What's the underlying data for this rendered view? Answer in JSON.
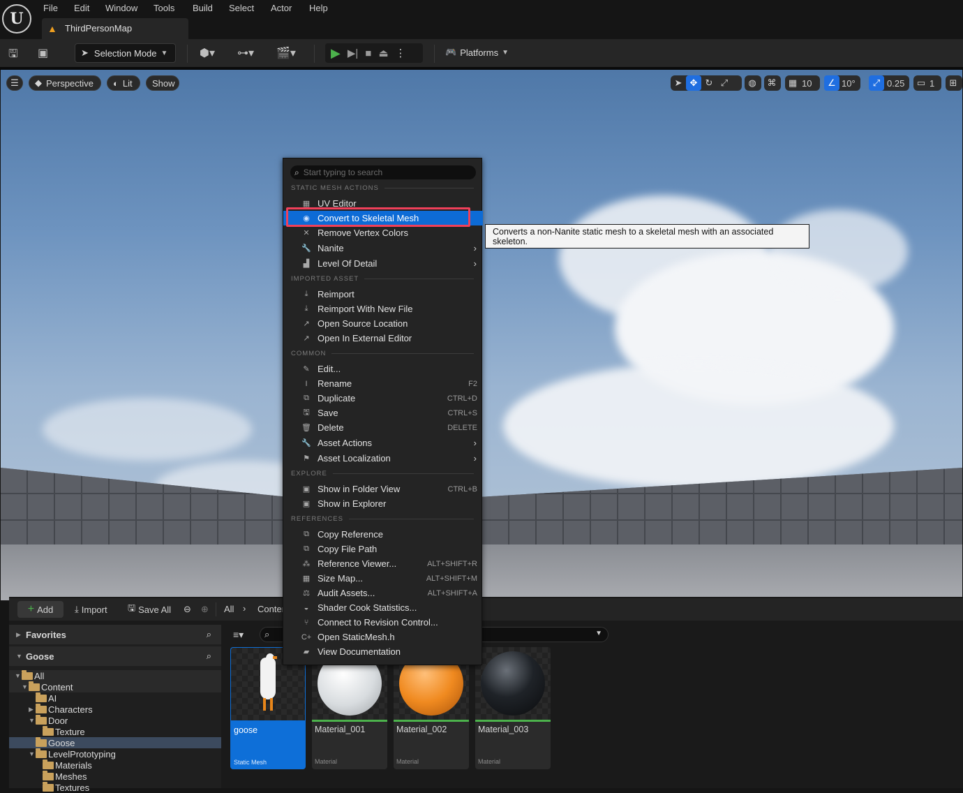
{
  "menubar": {
    "items": [
      "File",
      "Edit",
      "Window",
      "Tools",
      "Build",
      "Select",
      "Actor",
      "Help"
    ],
    "map_tab": "ThirdPersonMap"
  },
  "toolbar": {
    "selection_mode": "Selection Mode",
    "platforms": "Platforms"
  },
  "viewport": {
    "perspective": "Perspective",
    "lit": "Lit",
    "show": "Show",
    "grid_snap": "10",
    "rotation_snap": "10°",
    "scale_snap": "0.25",
    "camera_speed": "1"
  },
  "context_menu": {
    "search_placeholder": "Start typing to search",
    "sections": {
      "static_mesh": "STATIC MESH ACTIONS",
      "imported": "IMPORTED ASSET",
      "common": "COMMON",
      "explore": "EXPLORE",
      "references": "REFERENCES"
    },
    "items": {
      "uv_editor": "UV Editor",
      "convert_skeletal": "Convert to Skeletal Mesh",
      "remove_vertex_colors": "Remove Vertex Colors",
      "nanite": "Nanite",
      "level_of_detail": "Level Of Detail",
      "reimport": "Reimport",
      "reimport_new_file": "Reimport With New File",
      "open_source_location": "Open Source Location",
      "open_external_editor": "Open In External Editor",
      "edit": "Edit...",
      "rename": "Rename",
      "duplicate": "Duplicate",
      "save": "Save",
      "delete": "Delete",
      "asset_actions": "Asset Actions",
      "asset_localization": "Asset Localization",
      "show_folder_view": "Show in Folder View",
      "show_explorer": "Show in Explorer",
      "copy_reference": "Copy Reference",
      "copy_file_path": "Copy File Path",
      "reference_viewer": "Reference Viewer...",
      "size_map": "Size Map...",
      "audit_assets": "Audit Assets...",
      "shader_cook": "Shader Cook Statistics...",
      "revision_control": "Connect to Revision Control...",
      "open_header": "Open StaticMesh.h",
      "view_docs": "View Documentation"
    },
    "shortcuts": {
      "rename": "F2",
      "duplicate": "CTRL+D",
      "save": "CTRL+S",
      "delete": "DELETE",
      "show_folder_view": "CTRL+B",
      "reference_viewer": "ALT+SHIFT+R",
      "size_map": "ALT+SHIFT+M",
      "audit_assets": "ALT+SHIFT+A"
    }
  },
  "tooltip": "Converts a non-Nanite static mesh to a skeletal mesh with an associated skeleton.",
  "content_browser": {
    "add": "Add",
    "import": "Import",
    "save_all": "Save All",
    "path_all": "All",
    "path_content": "Conter",
    "favorites": "Favorites",
    "project": "Goose",
    "tree": {
      "all": "All",
      "content": "Content",
      "ai": "AI",
      "characters": "Characters",
      "door": "Door",
      "texture": "Texture",
      "goose": "Goose",
      "level_prototyping": "LevelPrototyping",
      "materials": "Materials",
      "meshes": "Meshes",
      "textures": "Textures"
    },
    "assets": [
      {
        "name": "goose",
        "type": "Static Mesh"
      },
      {
        "name": "Material_001",
        "type": "Material"
      },
      {
        "name": "Material_002",
        "type": "Material"
      },
      {
        "name": "Material_003",
        "type": "Material"
      }
    ]
  },
  "colors": {
    "accent_blue": "#0d6bd6",
    "highlight_red": "#f0405a",
    "play_green": "#4cb24c"
  }
}
